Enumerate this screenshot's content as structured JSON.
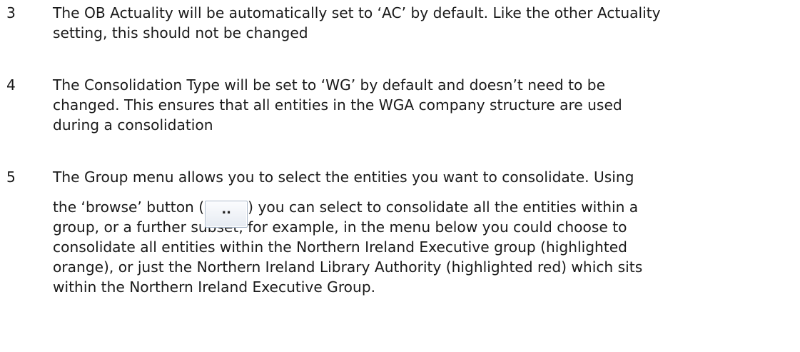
{
  "items": [
    {
      "number": "3",
      "lines": [
        "The OB Actuality will be automatically set to ‘AC’ by default. Like the other Actuality",
        "setting, this should not be changed"
      ]
    },
    {
      "number": "4",
      "lines": [
        "The Consolidation Type will be set to ‘WG’ by default and doesn’t need to be",
        "changed. This ensures that all entities in the WGA company structure are used",
        "during a consolidation"
      ]
    },
    {
      "number": "5",
      "lines": [
        "The Group menu allows you to select the entities you want to consolidate. Using"
      ],
      "browse_line_before": "the ‘browse’ button (",
      "browse_button_label": "..",
      "browse_line_after": ") you can select to consolidate all the entities within a",
      "more_lines": [
        "group, or a further subset, for example, in the menu below you could choose to",
        "consolidate all entities within the Northern Ireland Executive group (highlighted",
        "orange), or just the Northern Ireland Library Authority (highlighted red) which sits",
        "within the Northern Ireland Executive Group."
      ]
    }
  ]
}
